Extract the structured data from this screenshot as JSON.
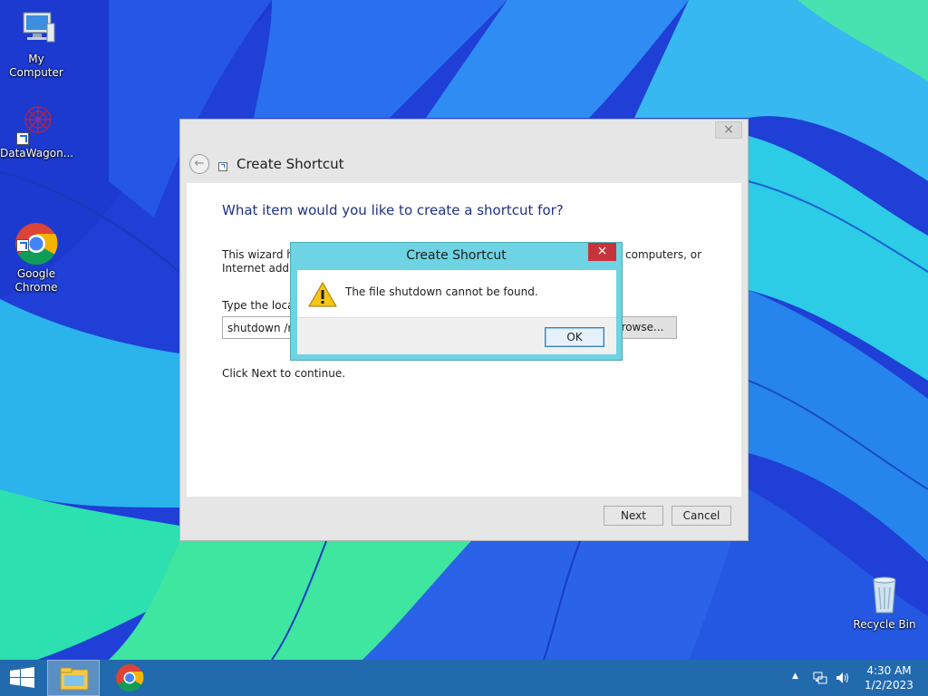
{
  "desktop": {
    "icons": [
      {
        "label": "My Computer",
        "icon": "computer-icon"
      },
      {
        "label": "DataWagon...",
        "icon": "datawagon-icon"
      },
      {
        "label": "Google\nChrome",
        "icon": "chrome-icon"
      },
      {
        "label": "Recycle Bin",
        "icon": "recycle-bin-icon"
      }
    ]
  },
  "wizard": {
    "title": "Create Shortcut",
    "close_label": "×",
    "back_label": "←",
    "question": "What item would you like to create a shortcut for?",
    "intro_left": "This wizard hel",
    "intro_left_line2": "Internet addres",
    "intro_right": "computers, or",
    "location_label": "Type the locati",
    "location_value": "shutdown /r /",
    "browse_label": "rowse...",
    "continue_text": "Click Next to continue.",
    "next_label": "Next",
    "cancel_label": "Cancel"
  },
  "dialog": {
    "title": "Create Shortcut",
    "close_label": "×",
    "message": "The file shutdown cannot be found.",
    "ok_label": "OK",
    "icon": "warning-icon"
  },
  "taskbar": {
    "items": [
      "start-icon",
      "file-explorer-icon",
      "chrome-icon"
    ],
    "tray_chevron": "▲",
    "time": "4:30 AM",
    "date": "1/2/2023"
  },
  "colors": {
    "wallpaper_blue": "#1f3fd6",
    "wallpaper_cyan": "#2cc4ea",
    "wallpaper_green": "#3ee6a0",
    "dialog_frame": "#6ed3e2",
    "close_red": "#c7333a",
    "heading_blue": "#1e3287",
    "taskbar": "#236eaa"
  }
}
